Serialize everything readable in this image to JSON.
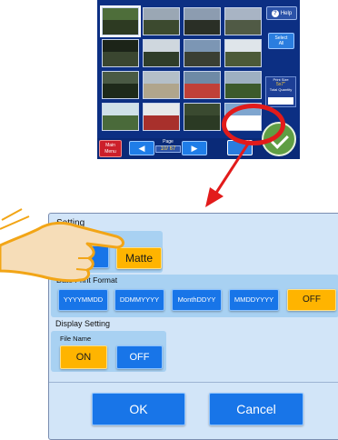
{
  "kiosk": {
    "help_label": "Help",
    "help_icon": "question-mark-icon",
    "select_all_line1": "Select",
    "select_all_line2": "All",
    "print_size_label": "Print Size",
    "print_size_value": "5x7\"",
    "total_quantity_label": "Total Quantity",
    "main_menu_line1": "Main",
    "main_menu_line2": "Menu",
    "prev_icon": "left-arrow-icon",
    "next_icon": "right-arrow-icon",
    "page_label": "Page",
    "page_value": "10/ 67",
    "confirm_icon": "checkmark-icon",
    "thumb_colors": [
      [
        "#4e6e3a",
        "#2d3a22",
        "#9aa7b4",
        "#3c4a2f",
        "#8c9cb0",
        "#2a2f26",
        "#a8b4c4",
        "#505a45"
      ],
      [
        "#1c2418",
        "#3a4630",
        "#cfd7de",
        "#2f3d29",
        "#7c96b4",
        "#3a3f33",
        "#dfe5ea",
        "#4c5a38"
      ],
      [
        "#4a5a44",
        "#1e2a1a",
        "#b4bfc8",
        "#b0a58c",
        "#6e8aa6",
        "#c04038",
        "#9eb0c2",
        "#3c5a2c"
      ],
      [
        "#cfe0e8",
        "#4a6a3a",
        "#e6e9ea",
        "#a8302c",
        "#3a4a30",
        "#2b3a24",
        "#7fa6cf",
        "#ffffff"
      ]
    ]
  },
  "dialog": {
    "paper_title": "Setting",
    "matte_label": "Matte",
    "date_format_label": "Date Print Format",
    "date_options": [
      "YYYYMMDD",
      "DDMMYYYY",
      "MonthDDYY",
      "MMDDYYYY"
    ],
    "date_off_label": "OFF",
    "display_setting_label": "Display Setting",
    "file_name_label": "File Name",
    "file_on_label": "ON",
    "file_off_label": "OFF",
    "ok_label": "OK",
    "cancel_label": "Cancel"
  },
  "colors": {
    "selected_orange": "#ffb400",
    "button_blue": "#1875e8",
    "highlight_red": "#e21b1b",
    "dialog_bg": "#d2e5f8"
  },
  "annotations": {
    "hand_icon": "pointing-hand-icon",
    "arrow_icon": "red-arrow-icon"
  }
}
